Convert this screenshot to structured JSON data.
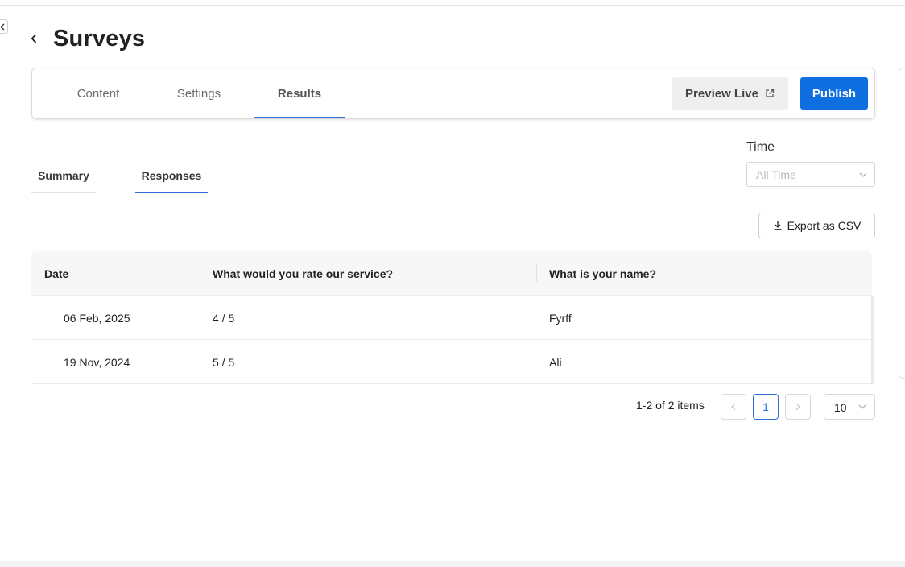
{
  "header": {
    "title": "Surveys"
  },
  "main_tabs": [
    {
      "label": "Content"
    },
    {
      "label": "Settings"
    },
    {
      "label": "Results",
      "active": true
    }
  ],
  "actions": {
    "preview_label": "Preview Live",
    "publish_label": "Publish"
  },
  "sub_tabs": [
    {
      "label": "Summary"
    },
    {
      "label": "Responses",
      "active": true
    }
  ],
  "filter": {
    "label": "Time",
    "placeholder": "All Time"
  },
  "export_label": "Export as CSV",
  "table": {
    "columns": [
      "Date",
      "What would you rate our service?",
      "What is your name?"
    ],
    "rows": [
      {
        "date": "06 Feb, 2025",
        "rating": "4 / 5",
        "name": "Fyrff"
      },
      {
        "date": "19 Nov, 2024",
        "rating": "5 / 5",
        "name": "Ali"
      }
    ]
  },
  "pagination": {
    "info": "1-2 of 2 items",
    "current_page": "1",
    "page_size": "10"
  },
  "colors": {
    "accent": "#0f6fe0",
    "tab_underline": "#2b6fd6"
  }
}
